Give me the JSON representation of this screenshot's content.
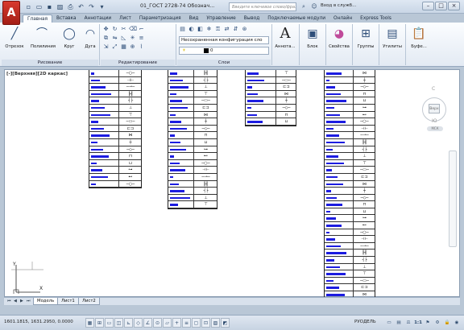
{
  "title": {
    "document": "01_ГОСТ 2728-74 Обознач...",
    "search_placeholder": "Введите ключевое слово/фразу",
    "signin": "Вход в служб..."
  },
  "tabs": [
    "Главная",
    "Вставка",
    "Аннотации",
    "Лист",
    "Параметризация",
    "Вид",
    "Управление",
    "Вывод",
    "Подключаемые модули",
    "Онлайн",
    "Express Tools"
  ],
  "ribbon": {
    "draw_tools": [
      {
        "icon": "line-icon",
        "glyph": "╱",
        "label": "Отрезок"
      },
      {
        "icon": "polyline-icon",
        "glyph": "⌒",
        "label": "Полилиния"
      },
      {
        "icon": "circle-icon",
        "glyph": "◯",
        "label": "Круг"
      },
      {
        "icon": "arc-icon",
        "glyph": "◠",
        "label": "Дуга"
      }
    ],
    "panels": {
      "draw": "Рисование",
      "modify": "Редактирование",
      "layers": "Слои"
    },
    "layer_state": "Несохраненная конфигурация сло",
    "layer_current": "0",
    "right_tools": [
      {
        "icon": "annotation-icon",
        "glyph": "A",
        "label": "Аннота..."
      },
      {
        "icon": "block-icon",
        "glyph": "▣",
        "label": "Блок"
      },
      {
        "icon": "properties-icon",
        "glyph": "◕",
        "label": "Свойства"
      },
      {
        "icon": "groups-icon",
        "glyph": "⊞",
        "label": "Группы"
      },
      {
        "icon": "utilities-icon",
        "glyph": "▤",
        "label": "Утилиты"
      },
      {
        "icon": "clipboard-icon",
        "glyph": "📋",
        "label": "Буфе..."
      }
    ]
  },
  "viewport": {
    "label": "[-][Верхняя][2D каркас]",
    "viewcube": {
      "north": "С",
      "south": "Ю",
      "top": "Верх",
      "wcs": "МСК"
    }
  },
  "layout_tabs": [
    "Модель",
    "Лист1",
    "Лист2"
  ],
  "status": {
    "coords": "1601.1815, 1631.2950, 0.0000",
    "model": "РУОДЕЛЬ",
    "scale": "1:1",
    "toggles": [
      "▦",
      "⊞",
      "▭",
      "◫",
      "⊾",
      "◇",
      "∠",
      "⊙",
      "▱",
      "+",
      "≡",
      "▢",
      "⊡",
      "▨",
      "◩"
    ]
  },
  "colors": {
    "accent_bar": "#1c1ce0",
    "app_logo": "#c8281c"
  }
}
